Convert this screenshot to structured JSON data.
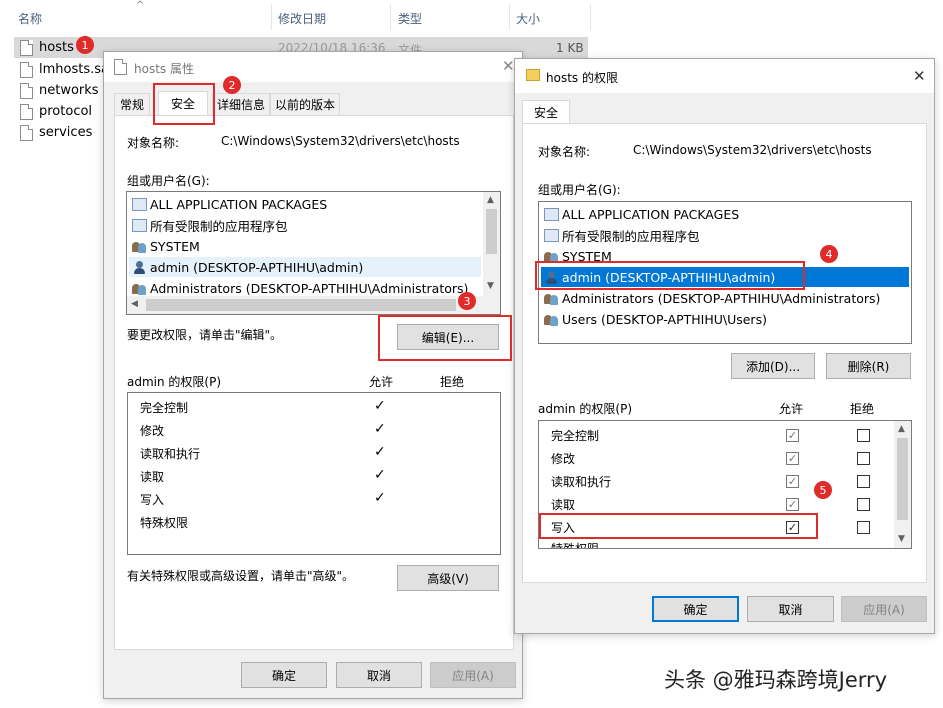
{
  "explorer": {
    "columns": {
      "name": "名称",
      "date": "修改日期",
      "type": "类型",
      "size": "大小"
    },
    "files": [
      {
        "name": "hosts",
        "date": "2022/10/18 16:36",
        "type": "文件",
        "size": "1 KB"
      },
      {
        "name": "lmhosts.sam"
      },
      {
        "name": "networks"
      },
      {
        "name": "protocol"
      },
      {
        "name": "services"
      }
    ]
  },
  "props_dialog": {
    "title": "hosts 属性",
    "tabs": [
      "常规",
      "安全",
      "详细信息",
      "以前的版本"
    ],
    "object_label": "对象名称:",
    "object_path": "C:\\Windows\\System32\\drivers\\etc\\hosts",
    "group_label": "组或用户名(G):",
    "users": [
      "ALL APPLICATION PACKAGES",
      "所有受限制的应用程序包",
      "SYSTEM",
      "admin (DESKTOP-APTHIHU\\admin)",
      "Administrators (DESKTOP-APTHIHU\\Administrators)"
    ],
    "edit_hint": "要更改权限，请单击\"编辑\"。",
    "edit_button": "编辑(E)...",
    "perm_label": "admin 的权限(P)",
    "allow": "允许",
    "deny": "拒绝",
    "permissions": [
      {
        "name": "完全控制",
        "allow": true
      },
      {
        "name": "修改",
        "allow": true
      },
      {
        "name": "读取和执行",
        "allow": true
      },
      {
        "name": "读取",
        "allow": true
      },
      {
        "name": "写入",
        "allow": true
      },
      {
        "name": "特殊权限",
        "allow": false
      }
    ],
    "advanced_hint": "有关特殊权限或高级设置，请单击\"高级\"。",
    "advanced_button": "高级(V)",
    "ok": "确定",
    "cancel": "取消",
    "apply": "应用(A)"
  },
  "perm_dialog": {
    "title": "hosts 的权限",
    "tab": "安全",
    "object_label": "对象名称:",
    "object_path": "C:\\Windows\\System32\\drivers\\etc\\hosts",
    "group_label": "组或用户名(G):",
    "users": [
      "ALL APPLICATION PACKAGES",
      "所有受限制的应用程序包",
      "SYSTEM",
      "admin (DESKTOP-APTHIHU\\admin)",
      "Administrators (DESKTOP-APTHIHU\\Administrators)",
      "Users (DESKTOP-APTHIHU\\Users)"
    ],
    "add_button": "添加(D)...",
    "remove_button": "删除(R)",
    "perm_label": "admin 的权限(P)",
    "allow": "允许",
    "deny": "拒绝",
    "permissions": [
      {
        "name": "完全控制",
        "allow": true,
        "deny": false
      },
      {
        "name": "修改",
        "allow": true,
        "deny": false
      },
      {
        "name": "读取和执行",
        "allow": true,
        "deny": false
      },
      {
        "name": "读取",
        "allow": true,
        "deny": false
      },
      {
        "name": "写入",
        "allow": true,
        "deny": false
      },
      {
        "name": "特殊权限",
        "allow": false,
        "deny": false
      }
    ],
    "ok": "确定",
    "cancel": "取消",
    "apply": "应用(A)"
  },
  "annotations": [
    "1",
    "2",
    "3",
    "4",
    "5"
  ],
  "watermark": "头条 @雅玛森跨境Jerry",
  "colors": {
    "highlight": "#0078d7",
    "annotation": "#e02b2b"
  }
}
